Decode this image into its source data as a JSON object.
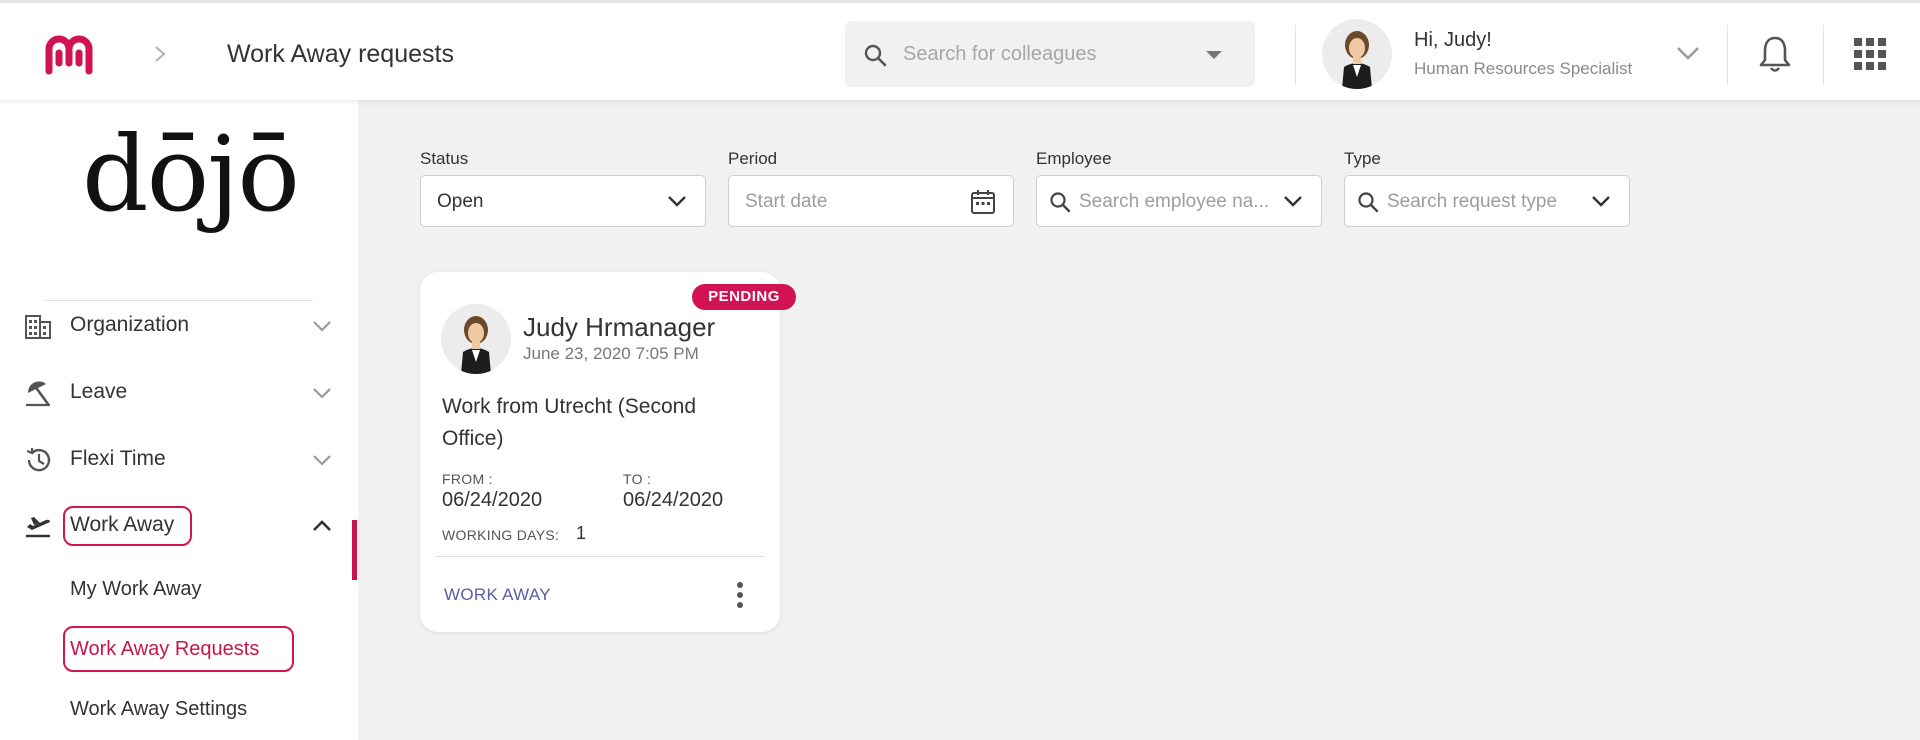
{
  "header": {
    "page_title": "Work Away requests",
    "search_placeholder": "Search for colleagues",
    "user_greeting": "Hi, Judy!",
    "user_role": "Human Resources Specialist"
  },
  "brand": {
    "logo_text": "dōjō"
  },
  "sidebar": {
    "items": [
      {
        "label": "Organization",
        "icon": "building-icon",
        "expanded": false
      },
      {
        "label": "Leave",
        "icon": "umbrella-icon",
        "expanded": false
      },
      {
        "label": "Flexi Time",
        "icon": "history-icon",
        "expanded": false
      },
      {
        "label": "Work Away",
        "icon": "plane-departure-icon",
        "expanded": true
      }
    ],
    "sub_items": [
      {
        "label": "My Work Away",
        "active": false
      },
      {
        "label": "Work Away Requests",
        "active": true
      },
      {
        "label": "Work Away Settings",
        "active": false
      }
    ]
  },
  "filters": {
    "status": {
      "label": "Status",
      "value": "Open"
    },
    "period": {
      "label": "Period",
      "placeholder": "Start date"
    },
    "employee": {
      "label": "Employee",
      "placeholder": "Search employee na..."
    },
    "type": {
      "label": "Type",
      "placeholder": "Search request type"
    }
  },
  "cards": [
    {
      "status": "PENDING",
      "name": "Judy Hrmanager",
      "created": "June 23, 2020 7:05 PM",
      "title": "Work from Utrecht (Second Office)",
      "from_label": "FROM :",
      "from": "06/24/2020",
      "to_label": "TO :",
      "to": "06/24/2020",
      "working_days_label": "WORKING DAYS:",
      "working_days": "1",
      "type": "WORK AWAY"
    }
  ],
  "colors": {
    "accent": "#c8164a",
    "badge": "#d21353",
    "type_link": "#5b5ea6",
    "background": "#f1f1f1"
  }
}
